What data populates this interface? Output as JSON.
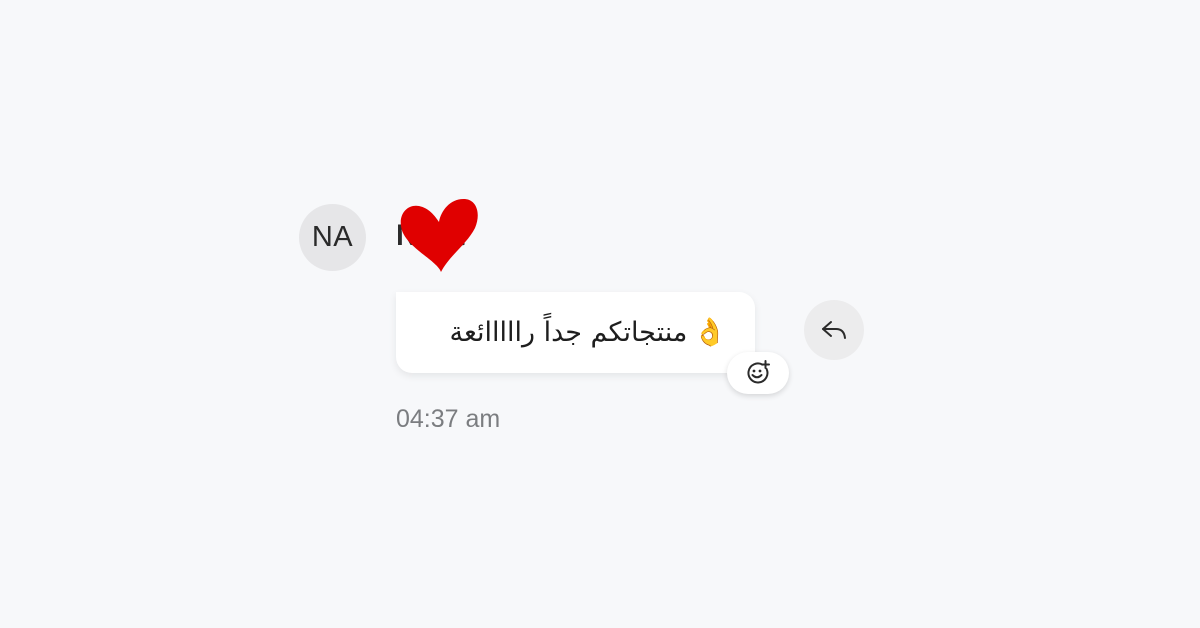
{
  "sender": {
    "initials": "NA",
    "name": "Nora"
  },
  "message": {
    "text": "منتجاتكم جداً رااااائعة",
    "emoji": "👌",
    "timestamp": "04:37 am",
    "reaction": "heart"
  },
  "actions": {
    "add_reaction_icon": "smiley-plus-icon",
    "reply_icon": "reply-arrow-icon"
  },
  "colors": {
    "background": "#f7f8fa",
    "bubble": "#ffffff",
    "heart": "#e00000",
    "avatar": "#e6e6e8"
  }
}
